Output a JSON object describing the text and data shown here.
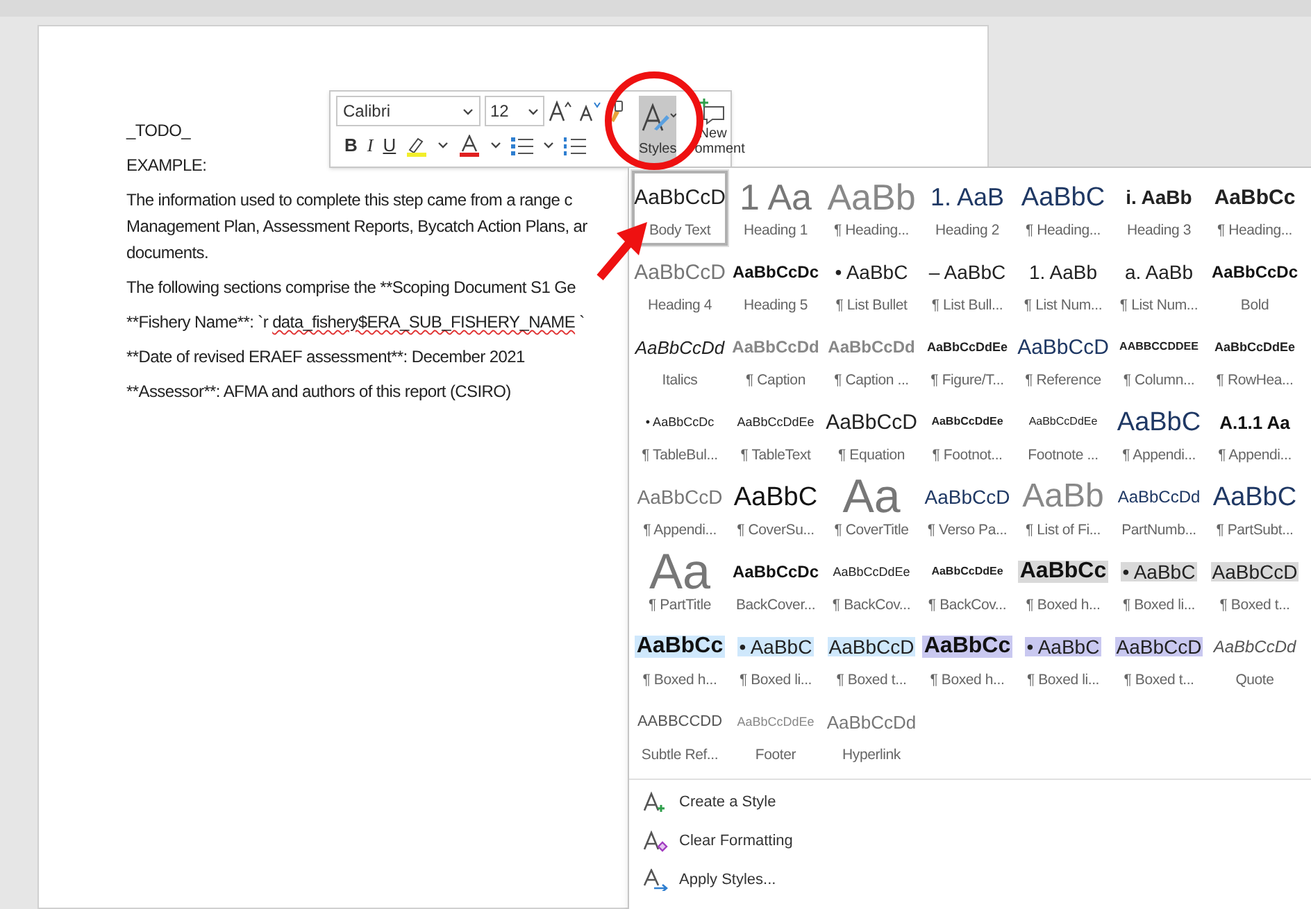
{
  "document": {
    "paragraphs": [
      {
        "kind": "plain",
        "lines": [
          "_TODO_"
        ]
      },
      {
        "kind": "plain",
        "lines": [
          "EXAMPLE:"
        ]
      },
      {
        "kind": "plain",
        "lines": [
          "The information used to complete this step came from a range c",
          "Management Plan, Assessment Reports, Bycatch Action Plans, ar",
          "documents."
        ]
      },
      {
        "kind": "plain",
        "lines": [
          "The following sections comprise the **Scoping Document S1 Ge"
        ]
      },
      {
        "kind": "flagged",
        "text": "**Fishery Name**: `r ",
        "flagged": "data_fishery$ERA_SUB_FISHERY_NAME",
        "suffix": " `"
      },
      {
        "kind": "plain",
        "lines": [
          "**Date of revised ERAEF assessment**: December 2021"
        ]
      },
      {
        "kind": "plain",
        "lines": [
          "**Assessor**: AFMA and authors of this report (CSIRO)"
        ]
      }
    ]
  },
  "mini_toolbar": {
    "format_buttons": [
      "B",
      "I",
      "U"
    ],
    "font": "Calibri",
    "size": "12",
    "styles_label": "Styles",
    "comment_label_1": "New",
    "comment_label_2": "omment"
  },
  "styles_gallery": {
    "items": [
      {
        "sample": "AaBbCcD",
        "label": "Body Text",
        "selected": true
      },
      {
        "sample": "1 Aa",
        "label": "Heading 1",
        "selected": false
      },
      {
        "sample": "AaBb",
        "label": "¶ Heading...",
        "selected": false
      },
      {
        "sample": "1. AaB",
        "label": "Heading 2",
        "selected": false
      },
      {
        "sample": "AaBbC",
        "label": "¶ Heading...",
        "selected": false
      },
      {
        "sample": "i. AaBb",
        "label": "Heading 3",
        "selected": false
      },
      {
        "sample": "AaBbCc",
        "label": "¶ Heading...",
        "selected": false
      },
      {
        "sample": "AaBbCcD",
        "label": "Heading 4",
        "selected": false
      },
      {
        "sample": "AaBbCcDc",
        "label": "Heading 5",
        "selected": false
      },
      {
        "sample": "• AaBbC",
        "label": "¶ List Bullet",
        "selected": false
      },
      {
        "sample": "– AaBbC",
        "label": "¶ List Bull...",
        "selected": false
      },
      {
        "sample": "1. AaBb",
        "label": "¶ List Num...",
        "selected": false
      },
      {
        "sample": "a. AaBb",
        "label": "¶ List Num...",
        "selected": false
      },
      {
        "sample": "AaBbCcDc",
        "label": "Bold",
        "selected": false
      },
      {
        "sample": "AaBbCcDd",
        "label": "Italics",
        "selected": false
      },
      {
        "sample": "AaBbCcDd",
        "label": "¶ Caption",
        "selected": false
      },
      {
        "sample": "AaBbCcDd",
        "label": "¶ Caption ...",
        "selected": false
      },
      {
        "sample": "AaBbCcDdEe",
        "label": "¶ Figure/T...",
        "selected": false
      },
      {
        "sample": "AaBbCcD",
        "label": "¶ Reference",
        "selected": false
      },
      {
        "sample": "AABBCCDDEE",
        "label": "¶ Column...",
        "selected": false
      },
      {
        "sample": "AaBbCcDdEe",
        "label": "¶ RowHea...",
        "selected": false
      },
      {
        "sample": "• AaBbCcDc",
        "label": "¶ TableBul...",
        "selected": false
      },
      {
        "sample": "AaBbCcDdEe",
        "label": "¶ TableText",
        "selected": false
      },
      {
        "sample": "AaBbCcD",
        "label": "¶ Equation",
        "selected": false
      },
      {
        "sample": "AaBbCcDdEe",
        "label": "¶ Footnot...",
        "selected": false
      },
      {
        "sample": "AaBbCcDdEe",
        "label": "Footnote ...",
        "selected": false
      },
      {
        "sample": "AaBbC",
        "label": "¶ Appendi...",
        "selected": false
      },
      {
        "sample": "A.1.1 Aa",
        "label": "¶ Appendi...",
        "selected": false
      },
      {
        "sample": "AaBbCcD",
        "label": "¶ Appendi...",
        "selected": false
      },
      {
        "sample": "AaBbC",
        "label": "¶ CoverSu...",
        "selected": false
      },
      {
        "sample": "Aa",
        "label": "¶ CoverTitle",
        "selected": false
      },
      {
        "sample": "AaBbCcD",
        "label": "¶ Verso Pa...",
        "selected": false
      },
      {
        "sample": "AaBb",
        "label": "¶ List of Fi...",
        "selected": false
      },
      {
        "sample": "AaBbCcDd",
        "label": "PartNumb...",
        "selected": false
      },
      {
        "sample": "AaBbC",
        "label": "¶ PartSubt...",
        "selected": false
      },
      {
        "sample": "Aa",
        "label": "¶ PartTitle",
        "selected": false
      },
      {
        "sample": "AaBbCcDc",
        "label": "BackCover...",
        "selected": false
      },
      {
        "sample": "AaBbCcDdEe",
        "label": "¶ BackCov...",
        "selected": false
      },
      {
        "sample": "AaBbCcDdEe",
        "label": "¶ BackCov...",
        "selected": false
      },
      {
        "sample": "AaBbCc",
        "label": "¶ Boxed h...",
        "selected": false,
        "color": "#d9d9d9"
      },
      {
        "sample": "• AaBbC",
        "label": "¶ Boxed li...",
        "selected": false,
        "color": "#d9d9d9"
      },
      {
        "sample": "AaBbCcD",
        "label": "¶ Boxed t...",
        "selected": false,
        "color": "#d9d9d9"
      },
      {
        "sample": "AaBbCc",
        "label": "¶ Boxed h...",
        "selected": false,
        "color": "#cfe8fc"
      },
      {
        "sample": "• AaBbC",
        "label": "¶ Boxed li...",
        "selected": false,
        "color": "#cfe8fc"
      },
      {
        "sample": "AaBbCcD",
        "label": "¶ Boxed t...",
        "selected": false,
        "color": "#cfe8fc"
      },
      {
        "sample": "AaBbCc",
        "label": "¶ Boxed h...",
        "selected": false,
        "color": "#c9c8f0"
      },
      {
        "sample": "• AaBbC",
        "label": "¶ Boxed li...",
        "selected": false,
        "color": "#c9c8f0"
      },
      {
        "sample": "AaBbCcD",
        "label": "¶ Boxed t...",
        "selected": false,
        "color": "#c9c8f0"
      },
      {
        "sample": "AaBbCcDd",
        "label": "Quote",
        "selected": false
      },
      {
        "sample": "AABBCCDD",
        "label": "Subtle Ref...",
        "selected": false
      },
      {
        "sample": "AaBbCcDdEe",
        "label": "Footer",
        "selected": false
      },
      {
        "sample": "AaBbCcDd",
        "label": "Hyperlink",
        "selected": false
      }
    ],
    "menu": [
      {
        "kind": "create",
        "label": "Create a Style"
      },
      {
        "kind": "clear",
        "label": "Clear Formatting"
      },
      {
        "kind": "apply",
        "label": "Apply Styles..."
      }
    ]
  }
}
